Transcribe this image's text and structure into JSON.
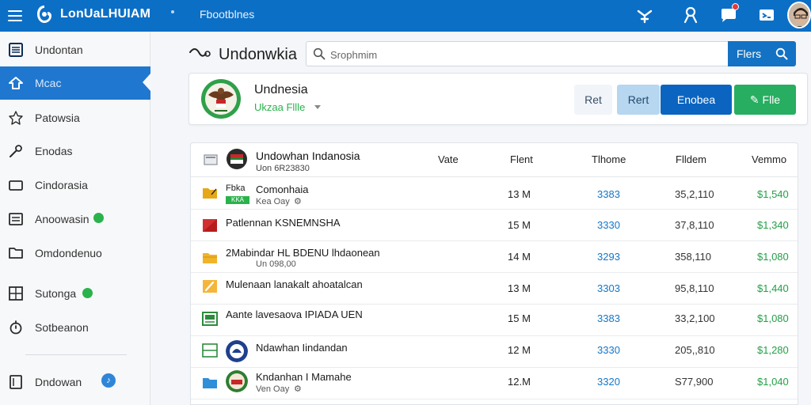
{
  "topbar": {
    "title": "LonUaLHUIAM",
    "tab": "Fbootblnes",
    "icons": [
      "menu-icon",
      "logo-icon",
      "bolt-icon",
      "user-icon",
      "chat-icon",
      "inbox-icon",
      "avatar"
    ]
  },
  "sidebar": {
    "items": [
      {
        "label": "Undontan",
        "icon": "list-icon"
      },
      {
        "label": "Mcac",
        "icon": "home-icon",
        "active": true
      },
      {
        "label": "Patowsia",
        "icon": "star-icon"
      },
      {
        "label": "Enodas",
        "icon": "wrench-icon"
      },
      {
        "label": "Cindorasia",
        "icon": "folder-icon"
      },
      {
        "label": "Anoowasin",
        "icon": "list-icon"
      },
      {
        "label": "Omdondenuo",
        "icon": "folder-icon"
      },
      {
        "label": "Sutonga",
        "icon": "grid-icon"
      },
      {
        "label": "Sotbeanon",
        "icon": "timer-icon"
      },
      {
        "label": "Dndowan",
        "icon": "document-icon",
        "badge": "♪"
      }
    ]
  },
  "header": {
    "title": "Undonwkia",
    "search_placeholder": "Srophmim",
    "filter_label": "Flers"
  },
  "profile": {
    "name": "Undnesia",
    "subtitle": "Ukzaa Fllle",
    "buttons": [
      "Ret",
      "Rert",
      "Enobea",
      "Flle"
    ]
  },
  "table": {
    "columns": [
      "Undowhan Indanosia",
      "Vate",
      "Flent",
      "Tlhome",
      "Flldem",
      "Vemmo"
    ],
    "header_sub": "Uon 6R23830",
    "rows": [
      {
        "name": "Comonhaia",
        "prefix": "Fbka",
        "badge": "KKA 0888",
        "sub": "Kea Oay",
        "size": "13 M",
        "a": "3383",
        "b": "35,2,110",
        "c": "$1,540",
        "icon": "folder-icon"
      },
      {
        "name": "Patlennan KSNEMNSHA",
        "size": "15 M",
        "a": "3330",
        "b": "37,8,110",
        "c": "$1,340",
        "icon": "red-file-icon"
      },
      {
        "name": "2Mabindar HL BDENU lhdaonean",
        "sub": "Un 098,00",
        "size": "14 M",
        "a": "3293",
        "b": "358,110",
        "c": "$1,080",
        "icon": "folder-icon"
      },
      {
        "name": "Mulenaan lanakalt ahoatalcan",
        "size": "13 M",
        "a": "3303",
        "b": "95,8,110",
        "c": "$1,440",
        "icon": "edit-icon"
      },
      {
        "name": "Aante lavesaova IPIADA UEN",
        "size": "15 M",
        "a": "3383",
        "b": "33,2,100",
        "c": "$1,080",
        "icon": "archive-icon"
      },
      {
        "name": "Ndawhan Iindandan",
        "size": "12 M",
        "a": "3330",
        "b": "205,,810",
        "c": "$1,280",
        "icon": "grid-icon"
      },
      {
        "name": "Kndanhan I Mamahe",
        "sub": "Ven Oay",
        "size": "12.M",
        "a": "3320",
        "b": "S77,900",
        "c": "$1,040",
        "icon": "folder-icon"
      }
    ]
  }
}
